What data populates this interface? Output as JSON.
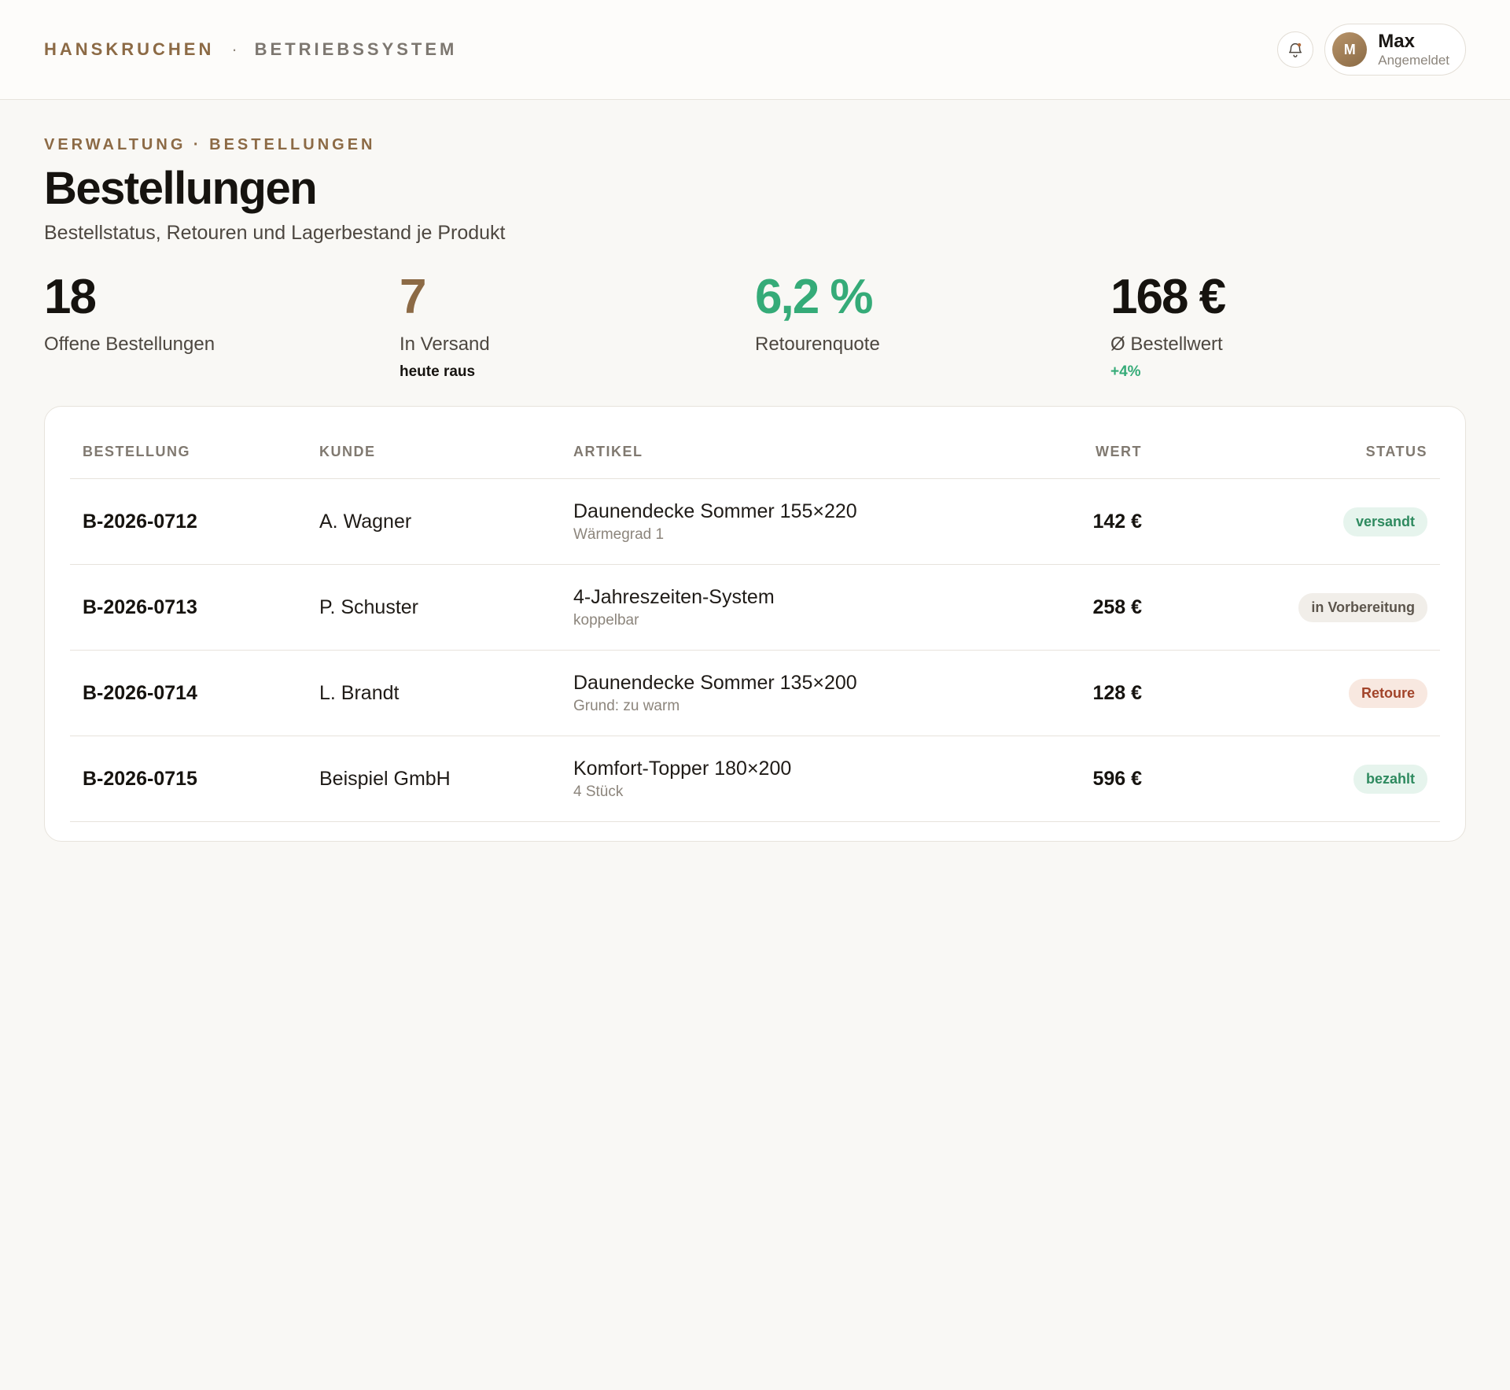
{
  "header": {
    "brand": "HANSKRUCHEN",
    "separator": "·",
    "system": "BETRIEBSSYSTEM",
    "user": {
      "initial": "M",
      "name": "Max",
      "status": "Angemeldet"
    }
  },
  "page": {
    "breadcrumb": "VERWALTUNG · BESTELLUNGEN",
    "title": "Bestellungen",
    "subtitle": "Bestellstatus, Retouren und Lagerbestand je Produkt"
  },
  "kpis": [
    {
      "value": "18",
      "label": "Offene Bestellungen",
      "note": "",
      "color": "#16130f"
    },
    {
      "value": "7",
      "label": "In Versand",
      "note": "heute raus",
      "color": "#8c6a45"
    },
    {
      "value": "6,2 %",
      "label": "Retourenquote",
      "note": "",
      "color": "#35ab78"
    },
    {
      "value": "168 €",
      "label": "Ø Bestellwert",
      "note": "+4%",
      "color": "#16130f"
    }
  ],
  "table": {
    "headers": [
      "BESTELLUNG",
      "KUNDE",
      "ARTIKEL",
      "WERT",
      "STATUS"
    ],
    "rows": [
      {
        "order": "B-2026-0712",
        "customer": "A. Wagner",
        "article": "Daunendecke Sommer 155×220",
        "detail": "Wärmegrad 1",
        "value": "142 €",
        "status": "versandt",
        "status_tone": "green"
      },
      {
        "order": "B-2026-0713",
        "customer": "P. Schuster",
        "article": "4-Jahreszeiten-System",
        "detail": "koppelbar",
        "value": "258 €",
        "status": "in Vorbereitung",
        "status_tone": "grey"
      },
      {
        "order": "B-2026-0714",
        "customer": "L. Brandt",
        "article": "Daunendecke Sommer 135×200",
        "detail": "Grund: zu warm",
        "value": "128 €",
        "status": "Retoure",
        "status_tone": "red"
      },
      {
        "order": "B-2026-0715",
        "customer": "Beispiel GmbH",
        "article": "Komfort-Topper 180×200",
        "detail": "4 Stück",
        "value": "596 €",
        "status": "bezahlt",
        "status_tone": "green"
      }
    ]
  },
  "colors": {
    "accent": "#8c6a45",
    "positive": "#35ab78",
    "background": "#f9f8f5"
  }
}
